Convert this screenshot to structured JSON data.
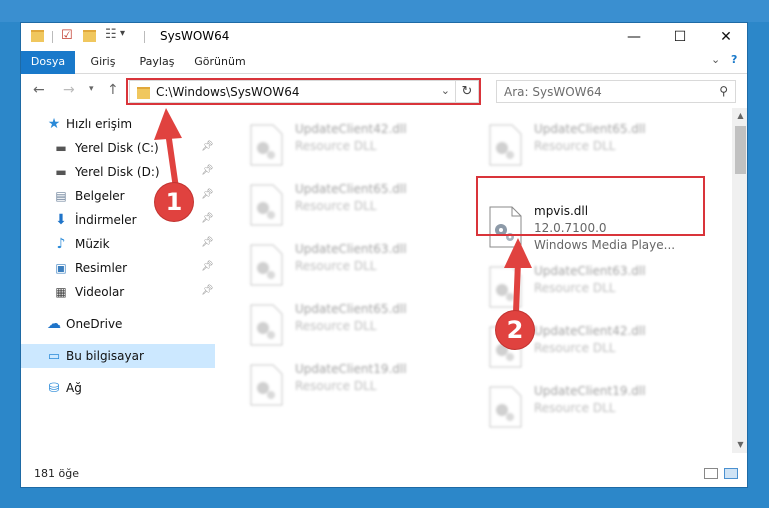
{
  "window": {
    "title": "SysWOW64"
  },
  "ribbon": {
    "tabs": [
      "Dosya",
      "Giriş",
      "Paylaş",
      "Görünüm"
    ]
  },
  "address": {
    "path": "C:\\Windows\\SysWOW64",
    "refresh_glyph": "↻"
  },
  "search": {
    "placeholder": "Ara: SysWOW64"
  },
  "navpane": {
    "quick_access": "Hızlı erişim",
    "items": [
      {
        "label": "Yerel Disk (C:)"
      },
      {
        "label": "Yerel Disk (D:)"
      },
      {
        "label": "Belgeler"
      },
      {
        "label": "İndirmeler"
      },
      {
        "label": "Müzik"
      },
      {
        "label": "Resimler"
      },
      {
        "label": "Videolar"
      }
    ],
    "onedrive": "OneDrive",
    "this_pc": "Bu bilgisayar",
    "network": "Ağ"
  },
  "files": [
    {
      "name": "UpdateClient42.dll",
      "desc": "Resource DLL"
    },
    {
      "name": "UpdateClient65.dll",
      "desc": "Resource DLL"
    },
    {
      "name": "UpdateClient65.dll",
      "desc": "Resource DLL"
    },
    {
      "name": "mpvis.dll",
      "version": "12.0.7100.0",
      "desc": "Windows Media Playe..."
    },
    {
      "name": "UpdateClient63.dll",
      "desc": "Resource DLL"
    },
    {
      "name": "UpdateClient63.dll",
      "desc": "Resource DLL"
    },
    {
      "name": "UpdateClient65.dll",
      "desc": "Resource DLL"
    },
    {
      "name": "UpdateClient42.dll",
      "desc": "Resource DLL"
    },
    {
      "name": "UpdateClient19.dll",
      "desc": "Resource DLL"
    },
    {
      "name": "UpdateClient19.dll",
      "desc": "Resource DLL"
    }
  ],
  "status": {
    "count": "181 öğe"
  },
  "annotations": {
    "step1": "1",
    "step2": "2"
  },
  "colors": {
    "accent": "#1979ca",
    "highlight": "#d9343a",
    "badge": "#e0423f"
  }
}
